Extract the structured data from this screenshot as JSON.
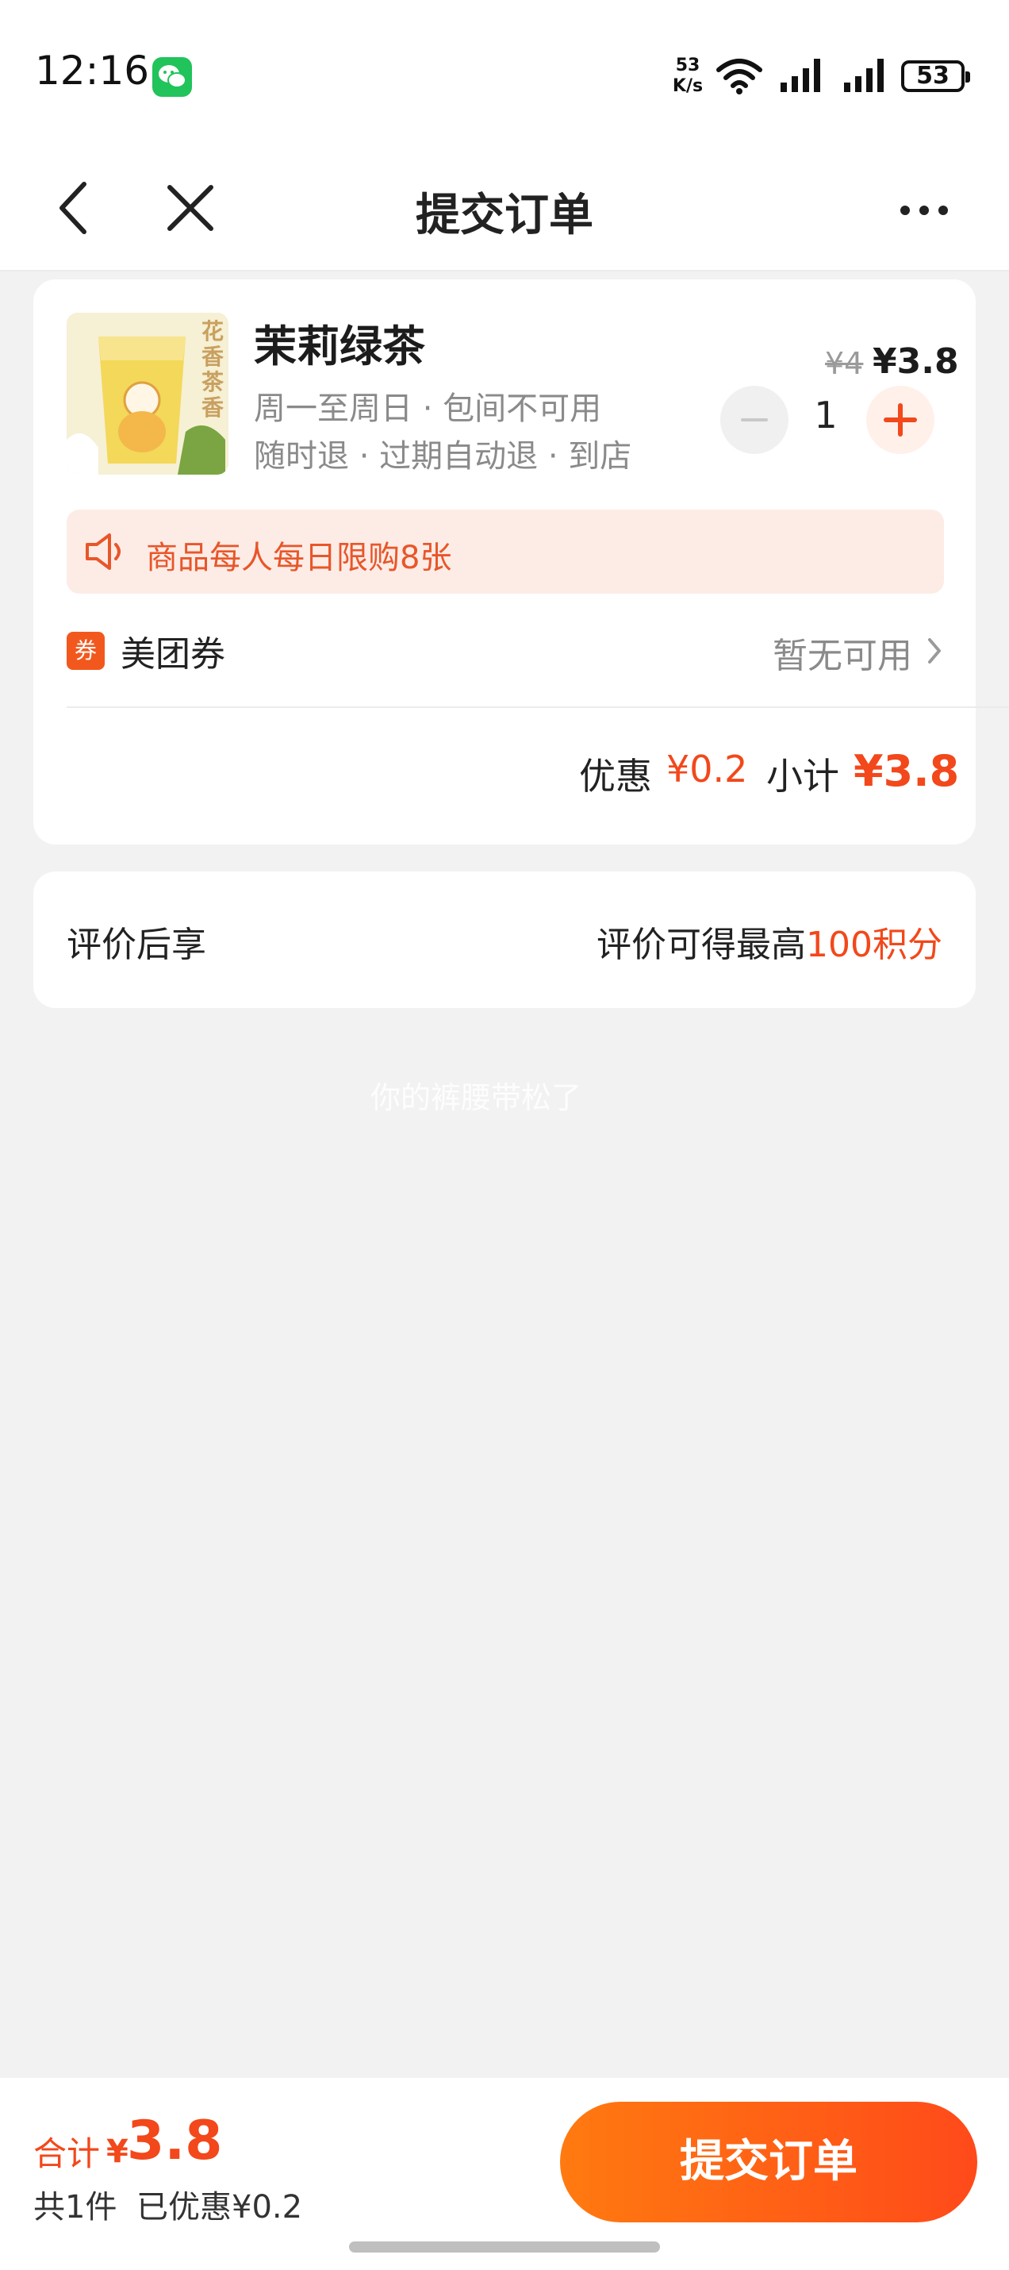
{
  "status_bar": {
    "time": "12:16",
    "net_speed_value": "53",
    "net_speed_unit": "K/s",
    "battery": "53",
    "icons": [
      "wechat-icon",
      "wifi-icon",
      "signal-icon",
      "signal-icon",
      "battery-icon"
    ]
  },
  "nav": {
    "title": "提交订单",
    "back_icon": "chevron-left-icon",
    "close_icon": "close-icon",
    "more_icon": "more-dots-icon"
  },
  "product": {
    "name": "茉莉绿茶",
    "meta_line1": "周一至周日 · 包间不可用",
    "meta_line2": "随时退 · 过期自动退 · 到店",
    "original_price": "¥4",
    "price": "¥3.8",
    "quantity": "1",
    "thumb_caption": "花香茶香"
  },
  "limit_notice": {
    "text": "商品每人每日限购8张",
    "icon": "speaker-icon"
  },
  "coupon": {
    "tag": "券",
    "label": "美团券",
    "status": "暂无可用"
  },
  "summary": {
    "discount_label": "优惠",
    "discount_value": "¥0.2",
    "subtotal_label": "小计",
    "subtotal_value": "¥3.8"
  },
  "review": {
    "left": "评价后享",
    "right_prefix": "评价可得最高",
    "right_points": "100积分"
  },
  "watermark": "你的裤腰带松了",
  "footer": {
    "total_label": "合计",
    "total_currency": "¥",
    "total_value": "3.8",
    "count": "共1件",
    "saved": "已优惠¥0.2",
    "submit_label": "提交订单"
  },
  "colors": {
    "accent": "#f2481b",
    "button_start": "#ff7a10",
    "button_end": "#ff4a1a",
    "page_bg": "#f2f2f2"
  }
}
